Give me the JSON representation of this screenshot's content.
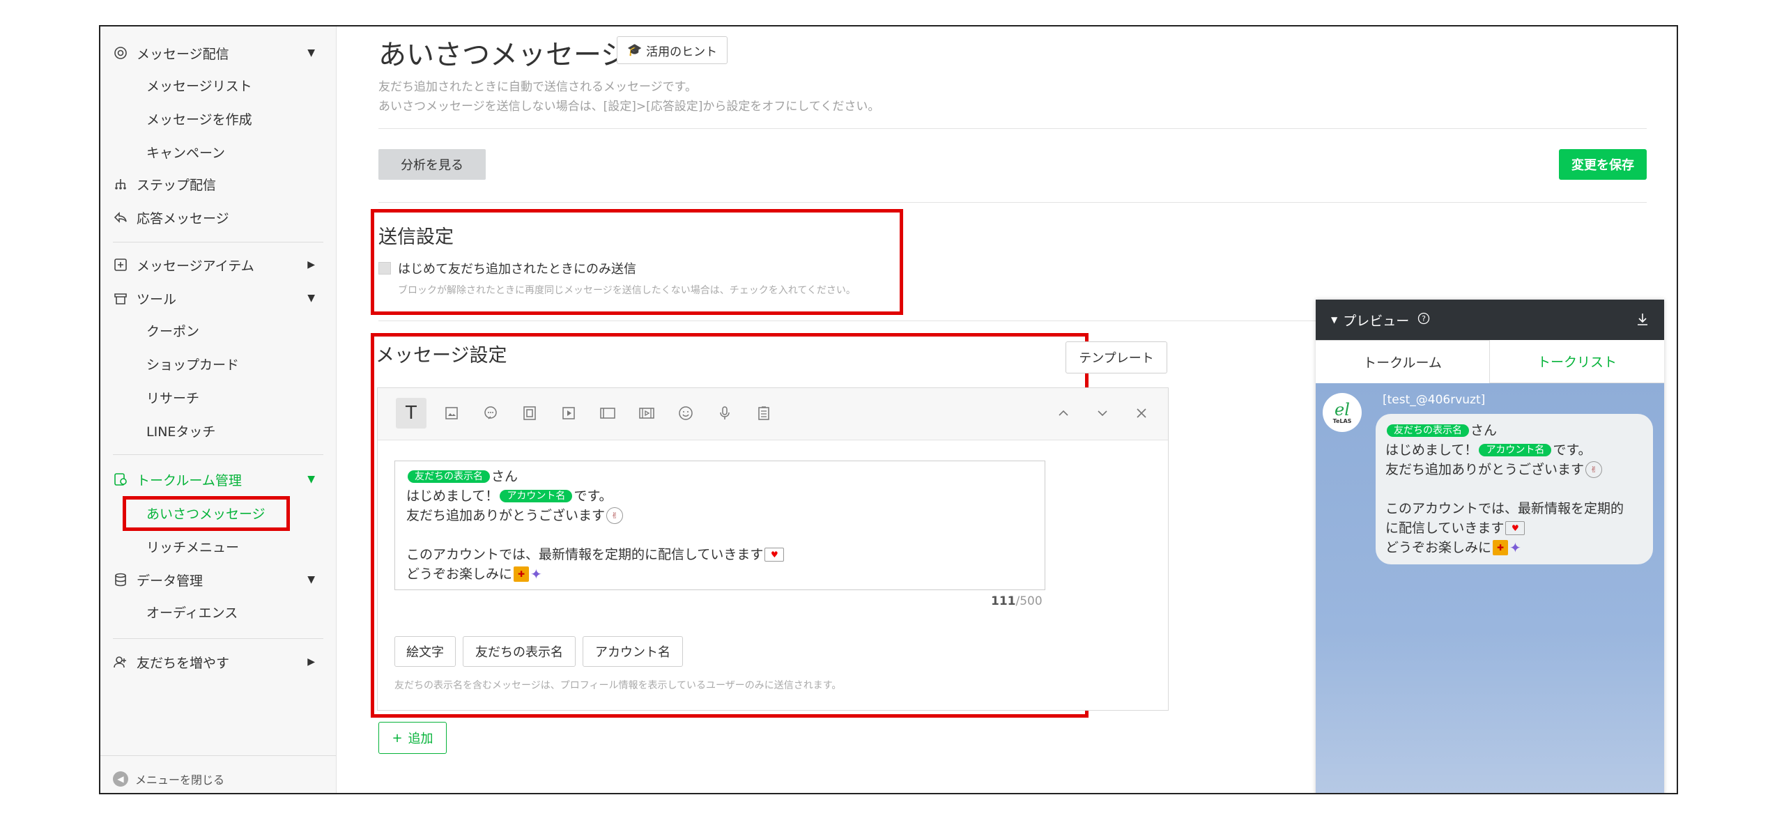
{
  "sidebar": {
    "message_delivery": "メッセージ配信",
    "message_list": "メッセージリスト",
    "create_message": "メッセージを作成",
    "campaign": "キャンペーン",
    "step_delivery": "ステップ配信",
    "auto_reply": "応答メッセージ",
    "message_items": "メッセージアイテム",
    "tools": "ツール",
    "coupon": "クーポン",
    "shop_card": "ショップカード",
    "research": "リサーチ",
    "line_touch": "LINEタッチ",
    "talkroom": "トークルーム管理",
    "greeting": "あいさつメッセージ",
    "rich_menu": "リッチメニュー",
    "data_mgmt": "データ管理",
    "audience": "オーディエンス",
    "add_friends": "友だちを増やす",
    "close_menu": "メニューを閉じる"
  },
  "header": {
    "title": "あいさつメッセージ",
    "hint": "活用のヒント",
    "desc1": "友だち追加されたときに自動で送信されるメッセージです。",
    "desc2": "あいさつメッセージを送信しない場合は、[設定]>[応答設定]から設定をオフにしてください。",
    "analysis": "分析を見る",
    "save": "変更を保存"
  },
  "send_settings": {
    "title": "送信設定",
    "checkbox_label": "はじめて友だち追加されたときにのみ送信",
    "note": "ブロックが解除されたときに再度同じメッセージを送信したくない場合は、チェックを入れてください。"
  },
  "message_settings": {
    "title": "メッセージ設定",
    "template": "テンプレート",
    "tag_display_name": "友だちの表示名",
    "tag_account_name": "アカウント名",
    "line1_suffix": "さん",
    "line2_prefix": "はじめまして！",
    "line2_suffix": "です。",
    "line3": "友だち追加ありがとうございます",
    "line5": "このアカウントでは、最新情報を定期的に配信していきます",
    "line6": "どうぞお楽しみに",
    "count": "111",
    "max": "/500",
    "chip_emoji": "絵文字",
    "chip_display_name": "友だちの表示名",
    "chip_account_name": "アカウント名",
    "footnote": "友だちの表示名を含むメッセージは、プロフィール情報を表示しているユーザーのみに送信されます。",
    "add": "追加"
  },
  "preview": {
    "title": "プレビュー",
    "tab_talkroom": "トークルーム",
    "tab_talklist": "トークリスト",
    "account": "[test_@406rvuzt]",
    "avatar_sub": "TeLAS",
    "tag_display_name": "友だちの表示名",
    "tag_account_name": "アカウント名",
    "line1_suffix": "さん",
    "line2_prefix": "はじめまして！",
    "line2_suffix": "です。",
    "line3": "友だち追加ありがとうございます",
    "line5a": "このアカウントでは、最新情報を定期的",
    "line5b": "に配信していきます",
    "line6": "どうぞお楽しみに"
  },
  "colors": {
    "accent": "#06c755",
    "highlight": "#e00000"
  }
}
